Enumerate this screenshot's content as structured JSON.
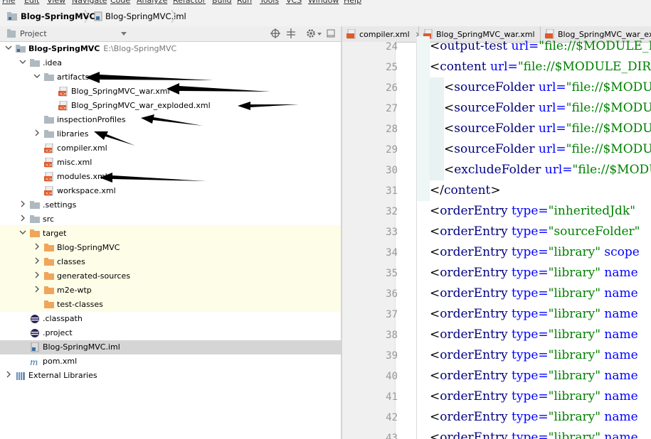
{
  "menu": [
    "File",
    "Edit",
    "View",
    "Navigate",
    "Code",
    "Analyze",
    "Refactor",
    "Build",
    "Run",
    "Tools",
    "VCS",
    "Window",
    "Help"
  ],
  "breadcrumb": {
    "project": "Blog-SpringMVC",
    "file": "Blog-SpringMVC.iml"
  },
  "project_panel": {
    "title": "Project"
  },
  "tree": [
    {
      "label": "Blog-SpringMVC",
      "path": "E:\\Blog-SpringMVC",
      "level": 0,
      "expanded": true,
      "icon": "module-folder-icon",
      "bold": true
    },
    {
      "label": ".idea",
      "level": 1,
      "expanded": true,
      "icon": "folder-icon"
    },
    {
      "label": "artifacts",
      "level": 2,
      "expanded": true,
      "icon": "folder-icon"
    },
    {
      "label": "Blog_SpringMVC_war.xml",
      "level": 3,
      "icon": "xml-file-icon"
    },
    {
      "label": "Blog_SpringMVC_war_exploded.xml",
      "level": 3,
      "icon": "xml-file-icon"
    },
    {
      "label": "inspectionProfiles",
      "level": 2,
      "icon": "folder-icon"
    },
    {
      "label": "libraries",
      "level": 2,
      "expanded": false,
      "icon": "folder-icon"
    },
    {
      "label": "compiler.xml",
      "level": 2,
      "icon": "xml-file-icon"
    },
    {
      "label": "misc.xml",
      "level": 2,
      "icon": "xml-file-icon"
    },
    {
      "label": "modules.xml",
      "level": 2,
      "icon": "xml-file-icon"
    },
    {
      "label": "workspace.xml",
      "level": 2,
      "icon": "xml-file-icon"
    },
    {
      "label": ".settings",
      "level": 1,
      "expanded": false,
      "icon": "folder-icon"
    },
    {
      "label": "src",
      "level": 1,
      "expanded": false,
      "icon": "folder-icon"
    },
    {
      "label": "target",
      "level": 1,
      "expanded": true,
      "icon": "orange-folder-icon"
    },
    {
      "label": "Blog-SpringMVC",
      "level": 2,
      "expanded": false,
      "icon": "orange-folder-icon"
    },
    {
      "label": "classes",
      "level": 2,
      "expanded": false,
      "icon": "orange-folder-icon"
    },
    {
      "label": "generated-sources",
      "level": 2,
      "expanded": false,
      "icon": "orange-folder-icon"
    },
    {
      "label": "m2e-wtp",
      "level": 2,
      "expanded": false,
      "icon": "orange-folder-icon"
    },
    {
      "label": "test-classes",
      "level": 2,
      "icon": "orange-folder-icon"
    },
    {
      "label": ".classpath",
      "level": 1,
      "icon": "eclipse-file-icon"
    },
    {
      "label": ".project",
      "level": 1,
      "icon": "eclipse-file-icon"
    },
    {
      "label": "Blog-SpringMVC.iml",
      "level": 1,
      "icon": "iml-file-icon",
      "selected": true
    },
    {
      "label": "pom.xml",
      "level": 1,
      "icon": "maven-file-icon"
    },
    {
      "label": "External Libraries",
      "level": 0,
      "expanded": false,
      "icon": "libraries-icon"
    }
  ],
  "tabs": [
    {
      "label": "compiler.xml",
      "close": "×"
    },
    {
      "label": "Blog_SpringMVC_war.xml",
      "close": "×"
    },
    {
      "label": "Blog_SpringMVC_war_exploded.xml",
      "close": "×"
    }
  ],
  "editor": {
    "lines": [
      {
        "num": "24",
        "indent": 0,
        "parts": [
          [
            "br",
            "<"
          ],
          [
            "tag",
            "output-test"
          ],
          [
            "attr",
            " url="
          ],
          [
            "val",
            "\"file://$MODULE_DIR$/target/test-classes\""
          ],
          [
            "br",
            " />"
          ]
        ]
      },
      {
        "num": "25",
        "indent": 0,
        "parts": [
          [
            "br",
            "<"
          ],
          [
            "tag",
            "content"
          ],
          [
            "attr",
            " url="
          ],
          [
            "val",
            "\"file://$MODULE_DIR$\""
          ],
          [
            "br",
            ">"
          ]
        ]
      },
      {
        "num": "26",
        "indent": 1,
        "parts": [
          [
            "br",
            "<"
          ],
          [
            "tag",
            "sourceFolder"
          ],
          [
            "attr",
            " url="
          ],
          [
            "val",
            "\"file://$MODULE_DIR$/src/main/java\""
          ]
        ]
      },
      {
        "num": "27",
        "indent": 1,
        "parts": [
          [
            "br",
            "<"
          ],
          [
            "tag",
            "sourceFolder"
          ],
          [
            "attr",
            " url="
          ],
          [
            "val",
            "\"file://$MODULE_DIR$/src/main/resources\""
          ]
        ]
      },
      {
        "num": "28",
        "indent": 1,
        "parts": [
          [
            "br",
            "<"
          ],
          [
            "tag",
            "sourceFolder"
          ],
          [
            "attr",
            " url="
          ],
          [
            "val",
            "\"file://$MODULE_DIR$/src/test/java\""
          ]
        ]
      },
      {
        "num": "29",
        "indent": 1,
        "parts": [
          [
            "br",
            "<"
          ],
          [
            "tag",
            "sourceFolder"
          ],
          [
            "attr",
            " url="
          ],
          [
            "val",
            "\"file://$MODULE_DIR$/src/test/resources\""
          ]
        ]
      },
      {
        "num": "30",
        "indent": 1,
        "parts": [
          [
            "br",
            "<"
          ],
          [
            "tag",
            "excludeFolder"
          ],
          [
            "attr",
            " url="
          ],
          [
            "val",
            "\"file://$MODULE_DIR$/target\""
          ]
        ]
      },
      {
        "num": "31",
        "indent": 0,
        "parts": [
          [
            "br",
            "</"
          ],
          [
            "tag",
            "content"
          ],
          [
            "br",
            ">"
          ]
        ]
      },
      {
        "num": "32",
        "indent": -1,
        "parts": [
          [
            "br",
            "<"
          ],
          [
            "tag",
            "orderEntry"
          ],
          [
            "attr",
            " type="
          ],
          [
            "val",
            "\"inheritedJdk\""
          ]
        ]
      },
      {
        "num": "33",
        "indent": -1,
        "parts": [
          [
            "br",
            "<"
          ],
          [
            "tag",
            "orderEntry"
          ],
          [
            "attr",
            " type="
          ],
          [
            "val",
            "\"sourceFolder\""
          ]
        ]
      },
      {
        "num": "34",
        "indent": -1,
        "parts": [
          [
            "br",
            "<"
          ],
          [
            "tag",
            "orderEntry"
          ],
          [
            "attr",
            " type="
          ],
          [
            "val",
            "\"library\""
          ],
          [
            "attr",
            " scope"
          ]
        ]
      },
      {
        "num": "35",
        "indent": -1,
        "parts": [
          [
            "br",
            "<"
          ],
          [
            "tag",
            "orderEntry"
          ],
          [
            "attr",
            " type="
          ],
          [
            "val",
            "\"library\""
          ],
          [
            "attr",
            " name"
          ]
        ]
      },
      {
        "num": "36",
        "indent": -1,
        "parts": [
          [
            "br",
            "<"
          ],
          [
            "tag",
            "orderEntry"
          ],
          [
            "attr",
            " type="
          ],
          [
            "val",
            "\"library\""
          ],
          [
            "attr",
            " name"
          ]
        ]
      },
      {
        "num": "37",
        "indent": -1,
        "parts": [
          [
            "br",
            "<"
          ],
          [
            "tag",
            "orderEntry"
          ],
          [
            "attr",
            " type="
          ],
          [
            "val",
            "\"library\""
          ],
          [
            "attr",
            " name"
          ]
        ]
      },
      {
        "num": "38",
        "indent": -1,
        "parts": [
          [
            "br",
            "<"
          ],
          [
            "tag",
            "orderEntry"
          ],
          [
            "attr",
            " type="
          ],
          [
            "val",
            "\"library\""
          ],
          [
            "attr",
            " name"
          ]
        ]
      },
      {
        "num": "39",
        "indent": -1,
        "parts": [
          [
            "br",
            "<"
          ],
          [
            "tag",
            "orderEntry"
          ],
          [
            "attr",
            " type="
          ],
          [
            "val",
            "\"library\""
          ],
          [
            "attr",
            " name"
          ]
        ]
      },
      {
        "num": "40",
        "indent": -1,
        "parts": [
          [
            "br",
            "<"
          ],
          [
            "tag",
            "orderEntry"
          ],
          [
            "attr",
            " type="
          ],
          [
            "val",
            "\"library\""
          ],
          [
            "attr",
            " name"
          ]
        ]
      },
      {
        "num": "41",
        "indent": -1,
        "parts": [
          [
            "br",
            "<"
          ],
          [
            "tag",
            "orderEntry"
          ],
          [
            "attr",
            " type="
          ],
          [
            "val",
            "\"library\""
          ],
          [
            "attr",
            " name"
          ]
        ]
      },
      {
        "num": "42",
        "indent": -1,
        "parts": [
          [
            "br",
            "<"
          ],
          [
            "tag",
            "orderEntry"
          ],
          [
            "attr",
            " type="
          ],
          [
            "val",
            "\"library\""
          ],
          [
            "attr",
            " name"
          ]
        ]
      },
      {
        "num": "43",
        "indent": -1,
        "parts": [
          [
            "br",
            "<"
          ],
          [
            "tag",
            "orderEntry"
          ],
          [
            "attr",
            " type="
          ],
          [
            "val",
            "\"library\""
          ],
          [
            "attr",
            " name"
          ]
        ]
      }
    ]
  },
  "colors": {
    "target_highlight": "#fdfde8",
    "selection": "#d5d5d5",
    "xml_tag": "#000080",
    "xml_attr": "#0000ff",
    "xml_value": "#008000",
    "folder": "#aeb9c0",
    "orange_folder": "#f0a55a"
  }
}
